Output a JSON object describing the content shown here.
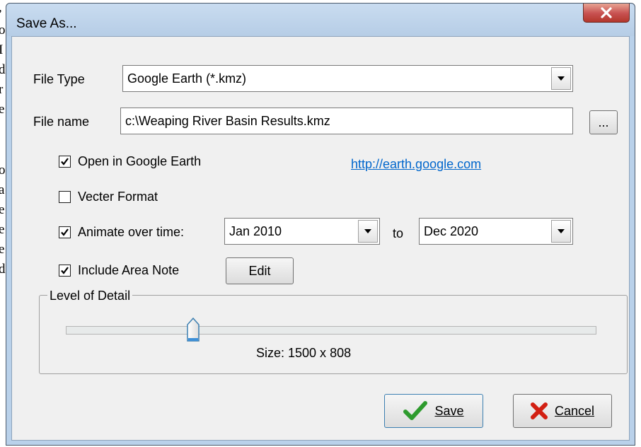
{
  "background_document": {
    "chars": [
      ",",
      "o",
      "I",
      "d",
      "r",
      "e",
      "o",
      "a",
      "e",
      "e",
      "e",
      "d"
    ]
  },
  "window": {
    "title": "Save As...",
    "close_icon": "close-x-icon"
  },
  "file_type": {
    "label": "File Type",
    "selected": "Google Earth (*.kmz)"
  },
  "file_name": {
    "label": "File name",
    "value": "c:\\Weaping River Basin Results.kmz",
    "browse_label": "..."
  },
  "options": {
    "open_google_earth": {
      "label": "Open in Google Earth",
      "checked": true
    },
    "link": "http://earth.google.com",
    "vecter_format": {
      "label": "Vecter Format",
      "checked": false
    },
    "animate": {
      "label": "Animate over time:",
      "checked": true,
      "from": "Jan 2010",
      "to_label": "to",
      "to": "Dec 2020"
    },
    "include_area_note": {
      "label": "Include Area Note",
      "checked": true,
      "edit_label": "Edit"
    }
  },
  "level_of_detail": {
    "title": "Level of Detail",
    "size_text": "Size: 1500 x 808",
    "slider_fraction": 0.24
  },
  "buttons": {
    "save_label": "Save",
    "save_icon": "checkmark-icon",
    "cancel_label": "Cancel",
    "cancel_icon": "red-x-icon"
  },
  "colors": {
    "window_frame": "#b9d1ea",
    "client_bg": "#f0f0f0",
    "link": "#0066cc",
    "close_button": "#c75050",
    "save_check": "#2e9b2e",
    "cancel_x": "#d21f12"
  }
}
